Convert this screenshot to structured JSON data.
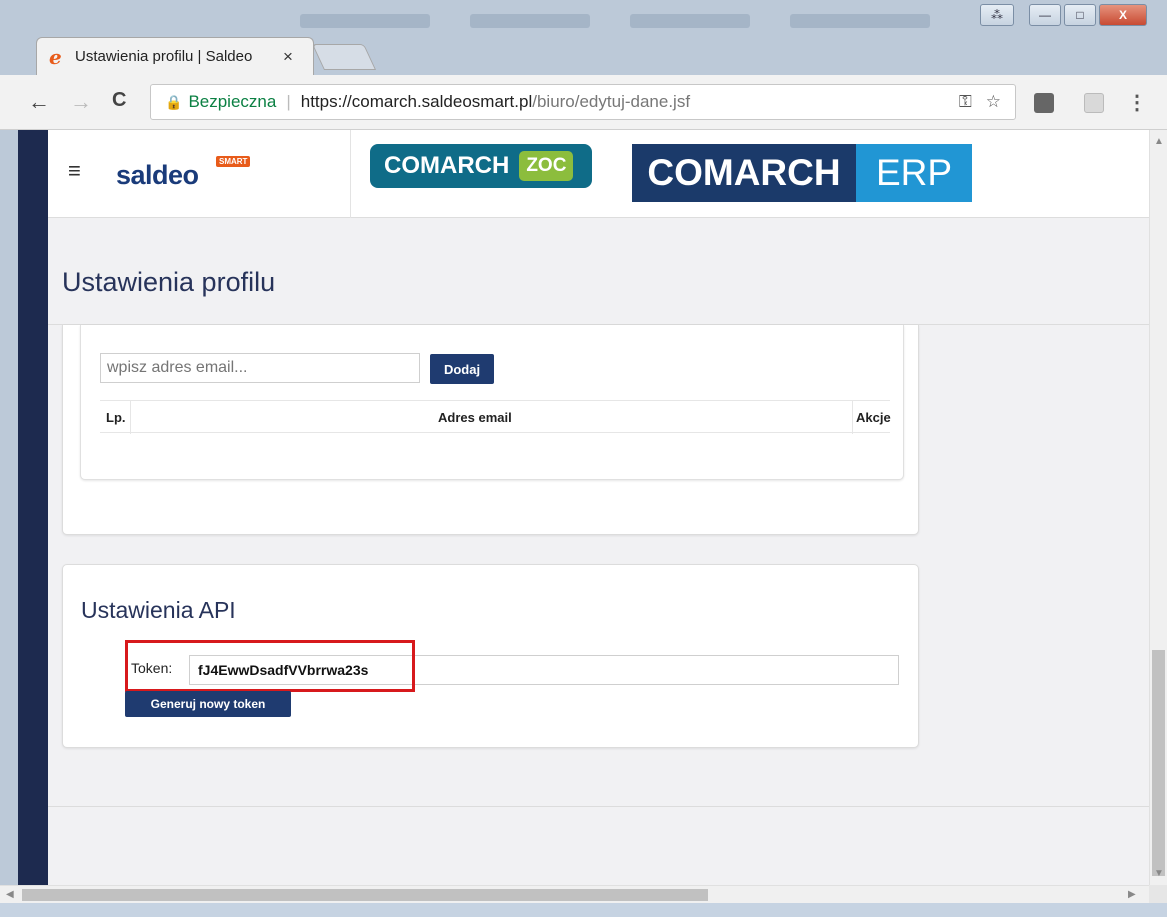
{
  "browser": {
    "tab_title": "Ustawienia profilu | Saldeo",
    "tab_close": "×",
    "nav": {
      "back": "←",
      "forward": "→",
      "reload": "C"
    },
    "secure_label": "Bezpieczna",
    "url_main": "https://comarch.saldeosmart.pl",
    "url_rest": "/biuro/edytuj-dane.jsf",
    "window_buttons": {
      "minimize": "—",
      "maximize": "□",
      "close": "X"
    }
  },
  "header": {
    "logo_text": "saldeo",
    "logo_badge": "SMART",
    "badge_zoc_left": "COMARCH",
    "badge_zoc_right": "ZOC",
    "badge_erp_left": "COMARCH",
    "badge_erp_right": "ERP"
  },
  "page": {
    "title": "Ustawienia profilu",
    "email_placeholder": "wpisz adres email...",
    "add_button": "Dodaj",
    "table_headers": [
      "Lp.",
      "Adres email",
      "Akcje"
    ]
  },
  "api": {
    "title": "Ustawienia API",
    "token_label": "Token:",
    "token_value": "fJ4EwwDsadfVVbrrwa23s",
    "generate_button": "Generuj nowy token"
  },
  "colors": {
    "rail": "#1d2a4f",
    "button": "#1f3b70",
    "highlight": "#d7191c",
    "zoc_green": "#8cbd3d",
    "erp_blue": "#2196d4"
  }
}
